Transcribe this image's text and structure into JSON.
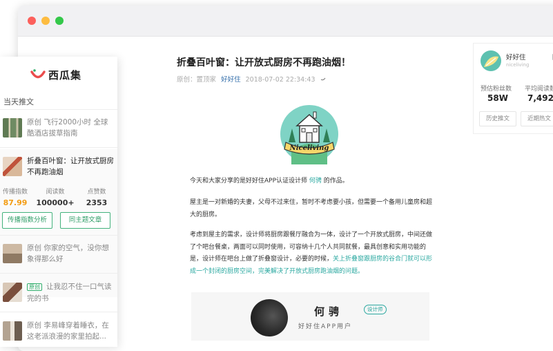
{
  "sidebar": {
    "logo_text": "西瓜集",
    "section_title": "当天推文",
    "items": [
      {
        "text": "原创  飞行2000小时  全球酷酒店拔草指南",
        "thumb_color": "#6f8b63"
      },
      {
        "text": "折叠百叶窗：让开放式厨房不再跑油烟",
        "thumb_color": "#c99b6b"
      },
      {
        "text": "原创  你家的空气，没你想象得那么好",
        "thumb_color": "#b7a08a"
      },
      {
        "badge": "原创",
        "text": "让我忍不住一口气读完的书",
        "thumb_color": "#8e6b5a"
      },
      {
        "text": "原创  李易峰穿着睡衣，在这老派浪漫的家里拍起...",
        "thumb_color": "#9c8c7a"
      }
    ],
    "stats": [
      {
        "label": "传播指数",
        "value": "87.99"
      },
      {
        "label": "阅读数",
        "value": "100000+"
      },
      {
        "label": "点赞数",
        "value": "2353"
      }
    ],
    "btn_analysis": "传播指数分析",
    "btn_same_topic": "同主题文章"
  },
  "article": {
    "title": "折叠百叶窗：让开放式厨房不再跑油烟！",
    "meta_prefix": "原创：",
    "meta_label": "置顶家",
    "author": "好好住",
    "date": "2018-07-02 22:34:43",
    "logo_text": "Niceliving",
    "p1_before": "今天和大家分享的是好好住APP认证设计师",
    "p1_link": "何骋",
    "p1_after": "的作品。",
    "p2": "屋主是一对新婚的夫妻，父母不过来住，暂时不考虑要小孩，但需要一个备用儿童房和超大的厨房。",
    "p3_plain": "考虑到屋主的需求，设计师将厨房跟餐厅融合为一体，设计了一个开放式厨房，中间还做了个吧台餐桌，两面可以同时使用，可容纳十几个人共同就餐，最具创意和实用功能的是，设计师在吧台上做了折叠窗设计，必要的时候，",
    "p3_link": "关上折叠窗跟厨房的谷合门就可以形成一个封闭的厨房空间，完美解决了开放式厨房跑油烟的问题。"
  },
  "designer_card": {
    "name": "何骋",
    "tag": "设计师",
    "subtitle": "好好住APP用户"
  },
  "account": {
    "name": "好好住",
    "handle": "niceliving",
    "cut_label": "日",
    "stats": [
      {
        "label": "预估粉丝数",
        "value": "58W"
      },
      {
        "label": "平均阅读数",
        "value": "7,492"
      }
    ],
    "btn_history": "历史推文",
    "btn_recent": "近期热文"
  }
}
